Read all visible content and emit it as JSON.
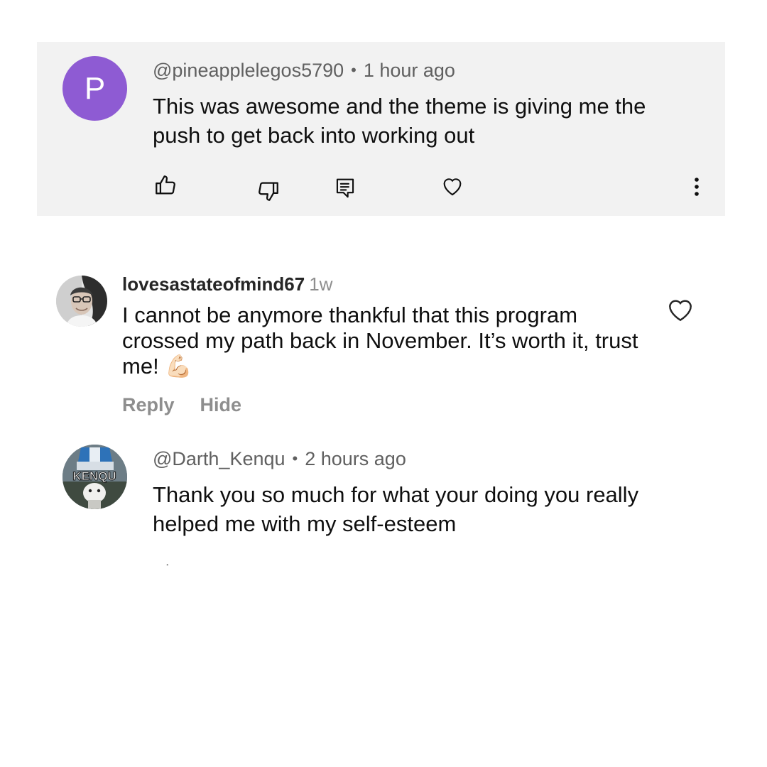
{
  "comment1": {
    "avatar_letter": "P",
    "avatar_color": "#8e5bd3",
    "username": "@pineapplelegos5790",
    "separator": "•",
    "time": "1 hour ago",
    "text": "This was awesome and the theme is giving me the push to get back into working out",
    "actions": [
      "thumbs-up-icon",
      "thumbs-down-icon",
      "reply-icon",
      "heart-icon",
      "more-vertical-icon"
    ]
  },
  "comment2": {
    "username": "lovesastateofmind67",
    "time": "1w",
    "text": "I cannot be anymore thankful that this program crossed my path back in November. It’s worth it, trust me!",
    "emoji": "💪🏻",
    "reply_label": "Reply",
    "hide_label": "Hide"
  },
  "comment3": {
    "username": "@Darth_Kenqu",
    "separator": "•",
    "time": "2 hours ago",
    "text": "Thank you so much for what your doing you really helped me with my self-esteem",
    "avatar_text": "KENQU"
  }
}
